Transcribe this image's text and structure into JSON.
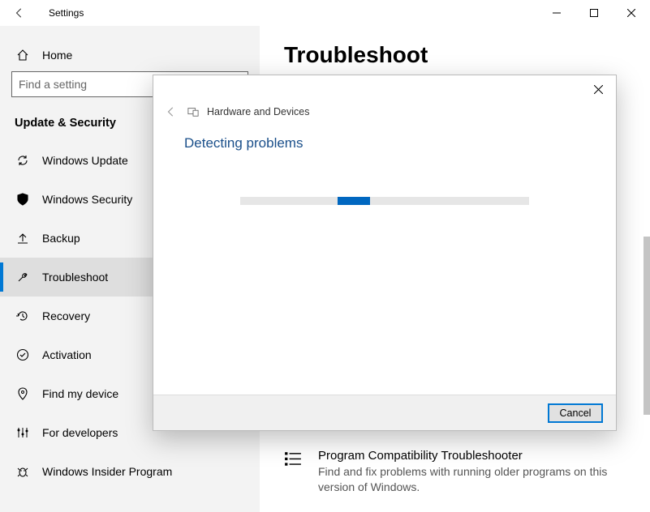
{
  "titlebar": {
    "title": "Settings"
  },
  "sidebar": {
    "home_label": "Home",
    "search_placeholder": "Find a setting",
    "section_header": "Update & Security",
    "items": [
      {
        "label": "Windows Update"
      },
      {
        "label": "Windows Security"
      },
      {
        "label": "Backup"
      },
      {
        "label": "Troubleshoot"
      },
      {
        "label": "Recovery"
      },
      {
        "label": "Activation"
      },
      {
        "label": "Find my device"
      },
      {
        "label": "For developers"
      },
      {
        "label": "Windows Insider Program"
      }
    ]
  },
  "content": {
    "page_title": "Troubleshoot",
    "item": {
      "title": "Program Compatibility Troubleshooter",
      "desc": "Find and fix problems with running older programs on this version of Windows."
    }
  },
  "dialog": {
    "title": "Hardware and Devices",
    "status": "Detecting problems",
    "cancel": "Cancel"
  }
}
